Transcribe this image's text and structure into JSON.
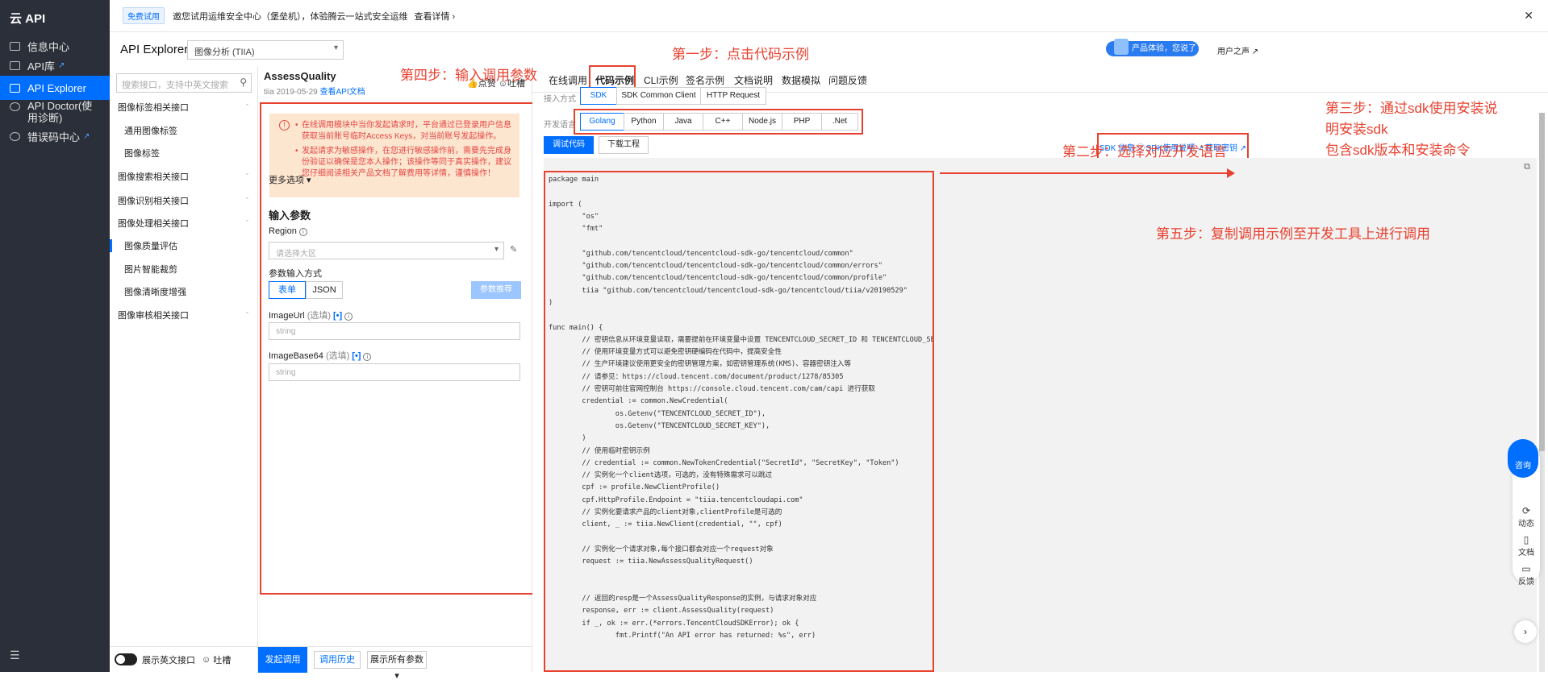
{
  "brand": "云 API",
  "nav": [
    {
      "label": "信息中心",
      "ext": false
    },
    {
      "label": "API库",
      "ext": true
    },
    {
      "label": "API Explorer",
      "ext": false
    },
    {
      "label": "API Doctor(使用诊断)",
      "ext": false
    },
    {
      "label": "错误码中心",
      "ext": true
    }
  ],
  "banner": {
    "tag": "免费试用",
    "text": "邀您试用运维安全中心（堡垒机），体验腾云一站式安全运维",
    "more": "查看详情 ›"
  },
  "header": {
    "title": "API Explorer",
    "product": "图像分析 (TIIA)",
    "promo": "产品体验，您说了算",
    "user": "用户之声"
  },
  "tree": {
    "search_placeholder": "搜索接口，支持中英文搜索",
    "rows": [
      {
        "label": "图像标签相关接口",
        "sub": false,
        "chev": "ˆ"
      },
      {
        "label": "通用图像标签",
        "sub": true,
        "chev": ""
      },
      {
        "label": "图像标签",
        "sub": true,
        "chev": ""
      },
      {
        "label": "图像搜索相关接口",
        "sub": false,
        "chev": "ˇ"
      },
      {
        "label": "图像识别相关接口",
        "sub": false,
        "chev": "ˇ"
      },
      {
        "label": "图像处理相关接口",
        "sub": false,
        "chev": "ˆ"
      },
      {
        "label": "图像质量评估",
        "sub": true,
        "chev": "",
        "sel": true
      },
      {
        "label": "图片智能裁剪",
        "sub": true,
        "chev": ""
      },
      {
        "label": "图像清晰度增强",
        "sub": true,
        "chev": ""
      },
      {
        "label": "图像审核相关接口",
        "sub": false,
        "chev": "ˇ"
      }
    ],
    "footer_toggle": "展示英文接口",
    "footer_feedback": "吐槽"
  },
  "param": {
    "name": "AssessQuality",
    "ver": "tiia 2019-05-29",
    "doc_link": "查看API文档",
    "like": "点赞",
    "complain": "吐槽",
    "warn": [
      "在线调用模块中当你发起请求时，平台通过已登录用户信息获取当前账号临时Access Keys，对当前账号发起操作。",
      "发起请求为敏感操作，在您进行敏感操作前，需要先完成身份验证以确保是您本人操作；该操作等同于真实操作，建议您仔细阅读相关产品文档了解费用等详情，谨慎操作！"
    ],
    "more": "更多选项 ▾",
    "input_title": "输入参数",
    "region_label": "Region",
    "region_placeholder": "请选择大区",
    "mode_label": "参数输入方式",
    "mode_form": "表单",
    "mode_json": "JSON",
    "recommend": "参数推荐",
    "url_label": "ImageUrl",
    "optional": "(选填)",
    "b64_label": "ImageBase64",
    "str_placeholder": "string",
    "go": "发起调用",
    "history": "调用历史",
    "show_all": "展示所有参数 ▾"
  },
  "right": {
    "tabs": [
      "在线调用",
      "代码示例",
      "CLI示例",
      "签名示例",
      "文档说明",
      "数据模拟",
      "问题反馈"
    ],
    "access_label": "接入方式",
    "access": [
      "SDK",
      "SDK Common Client",
      "HTTP Request"
    ],
    "lang_label": "开发语言",
    "langs": [
      "Golang",
      "Python",
      "Java",
      "C++",
      "Node.js",
      "PHP",
      ".Net"
    ],
    "debug": "调试代码",
    "download": "下载工程",
    "sdk_info": "SDK 信息 ⓘ",
    "sdk_doc": "SDK使用说明 ↗",
    "get_key": "获取密钥 ↗",
    "code": "package main\n\nimport (\n        \"os\"\n        \"fmt\"\n\n        \"github.com/tencentcloud/tencentcloud-sdk-go/tencentcloud/common\"\n        \"github.com/tencentcloud/tencentcloud-sdk-go/tencentcloud/common/errors\"\n        \"github.com/tencentcloud/tencentcloud-sdk-go/tencentcloud/common/profile\"\n        tiia \"github.com/tencentcloud/tencentcloud-sdk-go/tencentcloud/tiia/v20190529\"\n)\n\nfunc main() {\n        // 密钥信息从环境变量读取，需要提前在环境变量中设置 TENCENTCLOUD_SECRET_ID 和 TENCENTCLOUD_SECRET_KEY\n        // 使用环境变量方式可以避免密钥硬编码在代码中，提高安全性\n        // 生产环境建议使用更安全的密钥管理方案，如密钥管理系统(KMS)、容器密钥注入等\n        // 请参见：https://cloud.tencent.com/document/product/1278/85305\n        // 密钥可前往官网控制台 https://console.cloud.tencent.com/cam/capi 进行获取\n        credential := common.NewCredential(\n                os.Getenv(\"TENCENTCLOUD_SECRET_ID\"),\n                os.Getenv(\"TENCENTCLOUD_SECRET_KEY\"),\n        )\n        // 使用临时密钥示例\n        // credential := common.NewTokenCredential(\"SecretId\", \"SecretKey\", \"Token\")\n        // 实例化一个client选项，可选的，没有特殊需求可以跳过\n        cpf := profile.NewClientProfile()\n        cpf.HttpProfile.Endpoint = \"tiia.tencentcloudapi.com\"\n        // 实例化要请求产品的client对象,clientProfile是可选的\n        client, _ := tiia.NewClient(credential, \"\", cpf)\n\n        // 实例化一个请求对象,每个接口都会对应一个request对象\n        request := tiia.NewAssessQualityRequest()\n\n\n        // 返回的resp是一个AssessQualityResponse的实例，与请求对象对应\n        response, err := client.AssessQuality(request)\n        if _, ok := err.(*errors.TencentCloudSDKError); ok {\n                fmt.Printf(\"An API error has returned: %s\", err)"
  },
  "annotations": {
    "step1": "第一步：点击代码示例",
    "step2": "第二步：选择对应开发语言",
    "step3_l1": "第三步：通过sdk使用安装说",
    "step3_l2": "明安装sdk",
    "step3_l3": "包含sdk版本和安装命令",
    "step4": "第四步：输入调用参数",
    "step5": "第五步：复制调用示例至开发工具上进行调用"
  },
  "float": {
    "ask": "咨询",
    "news": "动态",
    "doc": "文档",
    "feedback": "反馈"
  },
  "accent": "#006eff",
  "mark_color": "#e8412f"
}
